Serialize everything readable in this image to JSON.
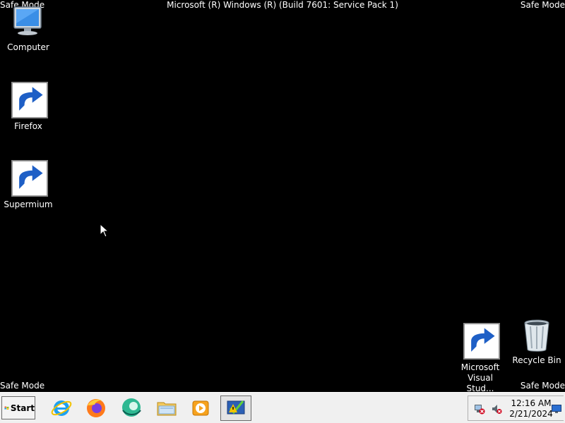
{
  "desktop": {
    "safe_mode_label": "Safe Mode",
    "build_text": "Microsoft (R) Windows (R) (Build 7601: Service Pack 1)",
    "background_color": "#000000",
    "icons": [
      {
        "label": "Computer",
        "icon": "computer-icon"
      },
      {
        "label": "Firefox",
        "icon": "firefox-icon"
      },
      {
        "label": "Supermium",
        "icon": "supermium-icon"
      },
      {
        "label": "Microsoft Visual Stud...",
        "icon": "visual-studio-icon"
      },
      {
        "label": "Recycle Bin",
        "icon": "recycle-bin-icon"
      }
    ]
  },
  "taskbar": {
    "start_label": "Start",
    "pinned": [
      {
        "name": "Internet Explorer",
        "icon": "internet-explorer-icon"
      },
      {
        "name": "Firefox",
        "icon": "firefox-icon"
      },
      {
        "name": "Supermium",
        "icon": "supermium-icon"
      },
      {
        "name": "Windows Explorer",
        "icon": "folder-icon"
      },
      {
        "name": "Media Player",
        "icon": "media-player-icon"
      },
      {
        "name": "Action Center",
        "icon": "action-center-icon"
      }
    ],
    "tray": {
      "time": "12:16 AM",
      "date": "2/21/2024",
      "icons": [
        "network-disconnected-icon",
        "volume-muted-icon",
        "show-desktop-icon"
      ]
    }
  }
}
